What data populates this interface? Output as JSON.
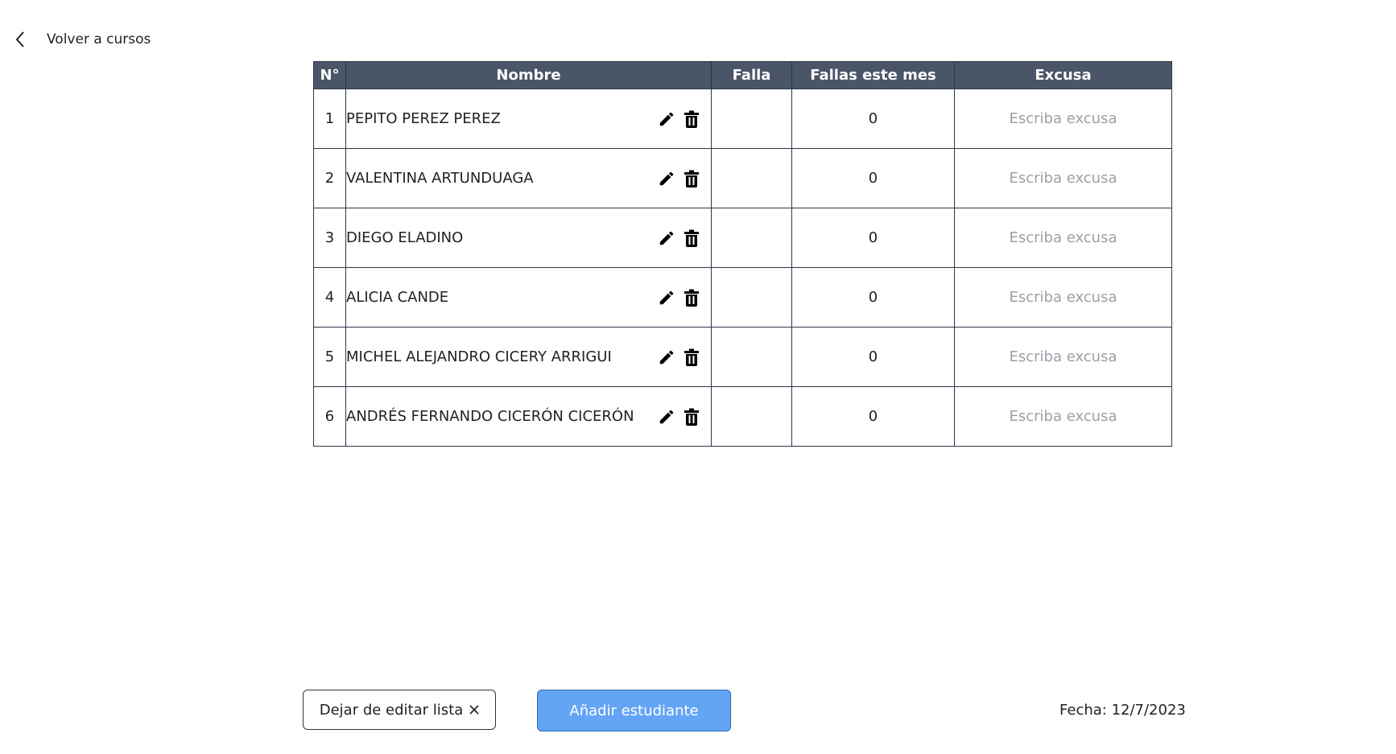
{
  "nav": {
    "back_label": "Volver a cursos"
  },
  "table": {
    "headers": {
      "num": "N°",
      "name": "Nombre",
      "falla": "Falla",
      "fallas_mes": "Fallas este mes",
      "excusa": "Excusa"
    },
    "excuse_placeholder": "Escriba excusa",
    "rows": [
      {
        "num": "1",
        "name": "PEPITO PEREZ PEREZ",
        "falla": "",
        "fallas_mes": "0",
        "excusa": ""
      },
      {
        "num": "2",
        "name": "VALENTINA ARTUNDUAGA",
        "falla": "",
        "fallas_mes": "0",
        "excusa": ""
      },
      {
        "num": "3",
        "name": "DIEGO ELADINO",
        "falla": "",
        "fallas_mes": "0",
        "excusa": ""
      },
      {
        "num": "4",
        "name": "ALICIA CANDE",
        "falla": "",
        "fallas_mes": "0",
        "excusa": ""
      },
      {
        "num": "5",
        "name": "MICHEL ALEJANDRO CICERY ARRIGUI",
        "falla": "",
        "fallas_mes": "0",
        "excusa": ""
      },
      {
        "num": "6",
        "name": "ANDRÉS FERNANDO CICERÓN CICERÓN",
        "falla": "",
        "fallas_mes": "0",
        "excusa": ""
      }
    ]
  },
  "footer": {
    "stop_edit_label": "Dejar de editar lista",
    "stop_edit_icon": "close-icon",
    "add_student_label": "Añadir estudiante",
    "date_text": "Fecha: 12/7/2023"
  },
  "colors": {
    "header_bg": "#4a5568",
    "primary_button": "#63a4f5",
    "placeholder": "#9aa0a6"
  }
}
